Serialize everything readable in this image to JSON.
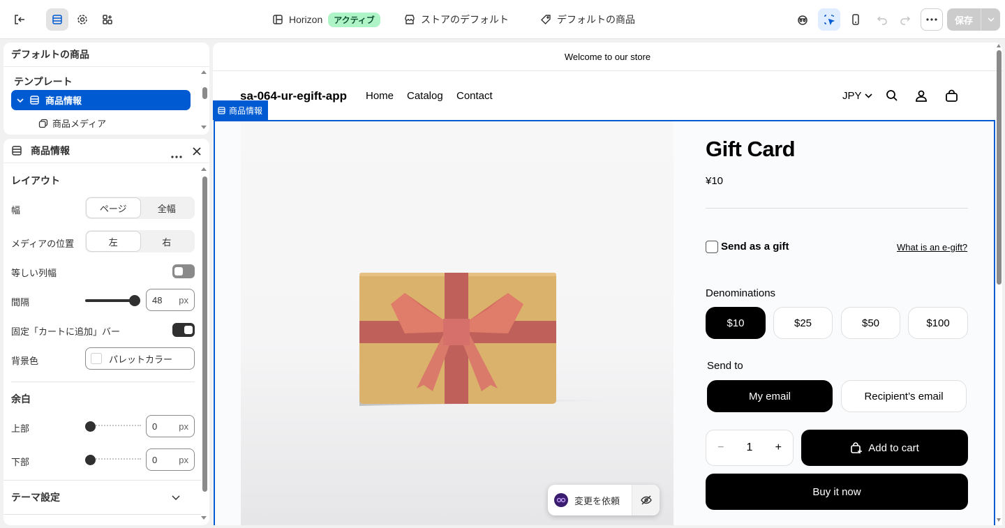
{
  "topbar": {
    "theme_name": "Horizon",
    "theme_status": "アクティブ",
    "store_default": "ストアのデフォルト",
    "default_product": "デフォルトの商品",
    "save_label": "保存"
  },
  "tree_panel": {
    "title": "デフォルトの商品",
    "template_label": "テンプレート",
    "selected_item": "商品情報",
    "child_item": "商品メディア"
  },
  "settings_panel": {
    "title": "商品情報",
    "layout_heading": "レイアウト",
    "width_label": "幅",
    "width_options": [
      "ページ",
      "全幅"
    ],
    "width_selected": "ページ",
    "media_position_label": "メディアの位置",
    "media_position_options": [
      "左",
      "右"
    ],
    "media_position_selected": "左",
    "equal_columns_label": "等しい列幅",
    "equal_columns_on": false,
    "gap_label": "間隔",
    "gap_value": "48",
    "gap_slider_fraction": 1.0,
    "unit": "px",
    "sticky_bar_label": "固定「カートに追加」バー",
    "sticky_bar_on": true,
    "background_label": "背景色",
    "background_value": "パレットカラー",
    "padding_heading": "余白",
    "top_label": "上部",
    "top_value": "0",
    "bottom_label": "下部",
    "bottom_value": "0",
    "theme_settings_label": "テーマ設定"
  },
  "store": {
    "announcement": "Welcome to our store",
    "logo": "sa-064-ur-egift-app",
    "nav": [
      "Home",
      "Catalog",
      "Contact"
    ],
    "currency": "JPY",
    "section_tag": "商品情報"
  },
  "product": {
    "title": "Gift Card",
    "price": "¥10",
    "send_as_gift": "Send as a gift",
    "what_is_egift": "What is an e-gift?",
    "denominations_label": "Denominations",
    "denominations": [
      "$10",
      "$25",
      "$50",
      "$100"
    ],
    "denomination_selected": "$10",
    "send_to_label": "Send to",
    "send_to_options": [
      "My email",
      "Recipient’s email"
    ],
    "send_to_selected": "My email",
    "quantity": "1",
    "add_to_cart": "Add to cart",
    "buy_now": "Buy it now"
  },
  "float_bar": {
    "request_change": "変更を依頼"
  },
  "colors": {
    "accent": "#005bd3",
    "badge_bg": "#aff4c6",
    "gift_box": "#dbb26c",
    "ribbon": "#c0605a"
  }
}
